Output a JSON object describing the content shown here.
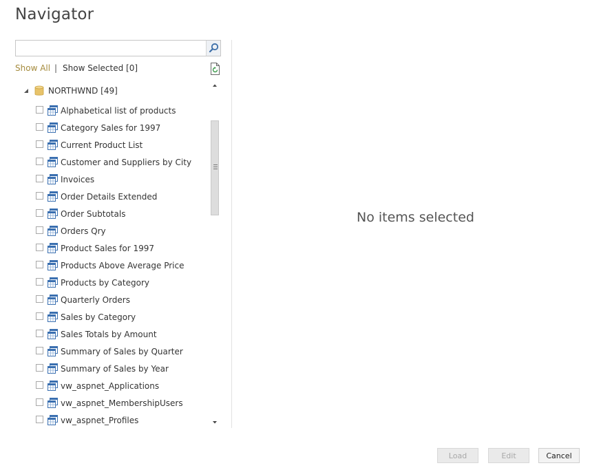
{
  "window": {
    "title": "Navigator"
  },
  "search": {
    "value": "",
    "placeholder": ""
  },
  "filters": {
    "show_all": "Show All",
    "separator": "|",
    "show_selected": "Show Selected [0]"
  },
  "tree": {
    "root": {
      "label": "NORTHWND [49]",
      "icon": "database-icon",
      "expanded": true
    },
    "items": [
      {
        "label": "Alphabetical list of products",
        "checked": false,
        "icon": "view-icon"
      },
      {
        "label": "Category Sales for 1997",
        "checked": false,
        "icon": "view-icon"
      },
      {
        "label": "Current Product List",
        "checked": false,
        "icon": "view-icon"
      },
      {
        "label": "Customer and Suppliers by City",
        "checked": false,
        "icon": "view-icon"
      },
      {
        "label": "Invoices",
        "checked": false,
        "icon": "view-icon"
      },
      {
        "label": "Order Details Extended",
        "checked": false,
        "icon": "view-icon"
      },
      {
        "label": "Order Subtotals",
        "checked": false,
        "icon": "view-icon"
      },
      {
        "label": "Orders Qry",
        "checked": false,
        "icon": "view-icon"
      },
      {
        "label": "Product Sales for 1997",
        "checked": false,
        "icon": "view-icon"
      },
      {
        "label": "Products Above Average Price",
        "checked": false,
        "icon": "view-icon"
      },
      {
        "label": "Products by Category",
        "checked": false,
        "icon": "view-icon"
      },
      {
        "label": "Quarterly Orders",
        "checked": false,
        "icon": "view-icon"
      },
      {
        "label": "Sales by Category",
        "checked": false,
        "icon": "view-icon"
      },
      {
        "label": "Sales Totals by Amount",
        "checked": false,
        "icon": "view-icon"
      },
      {
        "label": "Summary of Sales by Quarter",
        "checked": false,
        "icon": "view-icon"
      },
      {
        "label": "Summary of Sales by Year",
        "checked": false,
        "icon": "view-icon"
      },
      {
        "label": "vw_aspnet_Applications",
        "checked": false,
        "icon": "view-icon"
      },
      {
        "label": "vw_aspnet_MembershipUsers",
        "checked": false,
        "icon": "view-icon"
      },
      {
        "label": "vw_aspnet_Profiles",
        "checked": false,
        "icon": "view-icon"
      }
    ]
  },
  "preview": {
    "empty_message": "No items selected"
  },
  "buttons": {
    "load": "Load",
    "edit": "Edit",
    "cancel": "Cancel"
  },
  "colors": {
    "accent_link": "#a58b3d",
    "database_icon": "#e8c36a",
    "view_icon": "#3a6fb0"
  }
}
